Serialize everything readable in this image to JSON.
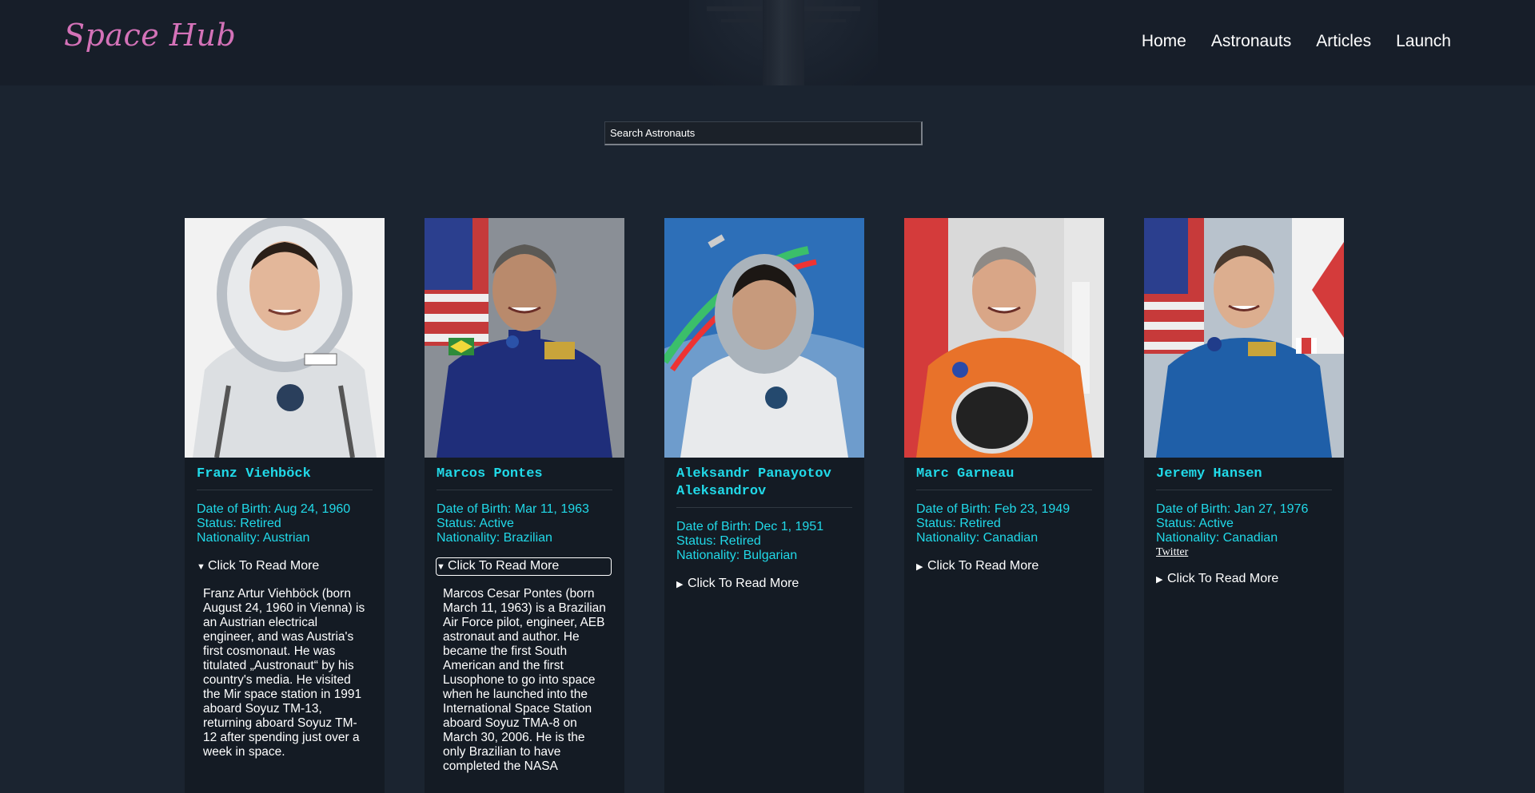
{
  "brand": "Space Hub",
  "nav": [
    "Home",
    "Astronauts",
    "Articles",
    "Launch"
  ],
  "search": {
    "placeholder": "Search Astronauts"
  },
  "astronauts": [
    {
      "name": "Franz Viehböck",
      "dob": "Date of Birth: Aug 24, 1960",
      "status": "Status: Retired",
      "nationality": "Nationality: Austrian",
      "toggle": "Click To Read More",
      "expanded": true,
      "bio": "Franz Artur Viehböck (born August 24, 1960 in Vienna) is an Austrian electrical engineer, and was Austria's first cosmonaut. He was titulated „Austronaut“ by his country's media. He visited the Mir space station in 1991 aboard Soyuz TM-13, returning aboard Soyuz TM-12 after spending just over a week in space."
    },
    {
      "name": "Marcos Pontes",
      "dob": "Date of Birth: Mar 11, 1963",
      "status": "Status: Active",
      "nationality": "Nationality: Brazilian",
      "toggle": "Click To Read More",
      "expanded": true,
      "bio": "Marcos Cesar Pontes (born March 11, 1963) is a Brazilian Air Force pilot, engineer, AEB astronaut and author. He became the first South American and the first Lusophone to go into space when he launched into the International Space Station aboard Soyuz TMA-8 on March 30, 2006. He is the only Brazilian to have completed the NASA"
    },
    {
      "name": "Aleksandr Panayotov Aleksandrov",
      "dob": "Date of Birth: Dec 1, 1951",
      "status": "Status: Retired",
      "nationality": "Nationality: Bulgarian",
      "toggle": "Click To Read More",
      "expanded": false
    },
    {
      "name": "Marc Garneau",
      "dob": "Date of Birth: Feb 23, 1949",
      "status": "Status: Retired",
      "nationality": "Nationality: Canadian",
      "toggle": "Click To Read More",
      "expanded": false
    },
    {
      "name": "Jeremy Hansen",
      "dob": "Date of Birth: Jan 27, 1976",
      "status": "Status: Active",
      "nationality": "Nationality: Canadian",
      "twitter": "Twitter",
      "toggle": "Click To Read More",
      "expanded": false
    }
  ],
  "colors": {
    "accent": "#21d9e8",
    "brand": "#d472b8",
    "card": "#141b24",
    "page": "#1b2430",
    "header": "#171e29"
  }
}
